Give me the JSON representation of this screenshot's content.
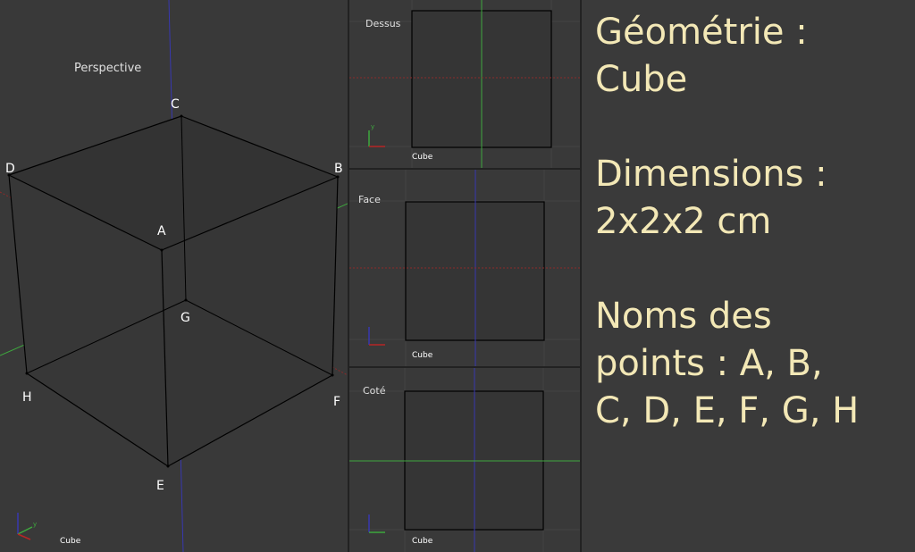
{
  "viewports": {
    "perspective": {
      "label": "Perspective",
      "object": "Cube"
    },
    "top": {
      "label": "Dessus",
      "object": "Cube"
    },
    "front": {
      "label": "Face",
      "object": "Cube"
    },
    "side": {
      "label": "Coté",
      "object": "Cube"
    }
  },
  "points": [
    "A",
    "B",
    "C",
    "D",
    "E",
    "F",
    "G",
    "H"
  ],
  "info": {
    "title_line1": "Géométrie :",
    "title_line2": "Cube",
    "dim_line1": "Dimensions :",
    "dim_line2": "2x2x2 cm",
    "names_line1": "Noms des",
    "names_line2": "points : A, B,",
    "names_line3": "C, D, E, F, G, H"
  },
  "colors": {
    "text_yellow": "#f3e8b6",
    "axis_x": "#b52626",
    "axis_y": "#3ea83e",
    "axis_z": "#3838b0",
    "grid": "#454545"
  }
}
